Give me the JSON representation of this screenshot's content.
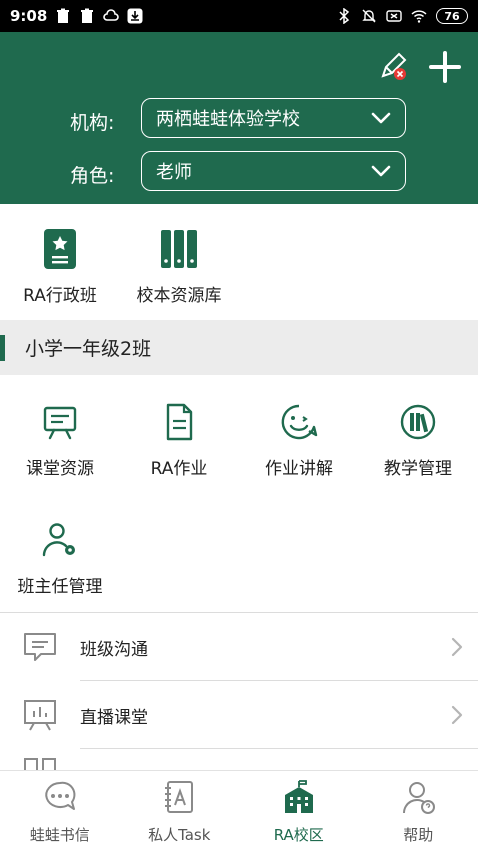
{
  "status_bar": {
    "time": "9:08",
    "battery": "76"
  },
  "header": {
    "org_label": "机构:",
    "org_value": "两栖蛙蛙体验学校",
    "role_label": "角色:",
    "role_value": "老师"
  },
  "quick_apps": [
    {
      "label": "RA行政班",
      "icon": "badge-star-icon"
    },
    {
      "label": "校本资源库",
      "icon": "books-icon"
    }
  ],
  "class_section": {
    "title": "小学一年级2班",
    "items": [
      {
        "label": "课堂资源",
        "icon": "presentation-board-icon"
      },
      {
        "label": "RA作业",
        "icon": "document-icon"
      },
      {
        "label": "作业讲解",
        "icon": "smile-chat-icon"
      },
      {
        "label": "教学管理",
        "icon": "books-circle-icon"
      },
      {
        "label": "班主任管理",
        "icon": "user-gear-icon"
      }
    ]
  },
  "list": [
    {
      "label": "班级沟通",
      "icon": "chat-bubble-icon"
    },
    {
      "label": "直播课堂",
      "icon": "live-board-icon"
    }
  ],
  "tabs": [
    {
      "label": "蛙蛙书信",
      "icon": "chat-dots-icon",
      "active": false
    },
    {
      "label": "私人Task",
      "icon": "notebook-a-icon",
      "active": false
    },
    {
      "label": "RA校区",
      "icon": "school-building-icon",
      "active": true
    },
    {
      "label": "帮助",
      "icon": "help-user-icon",
      "active": false
    }
  ],
  "colors": {
    "brand_green": "#1f6a4e",
    "section_gray": "#ececec",
    "alert_red": "#e53935"
  }
}
